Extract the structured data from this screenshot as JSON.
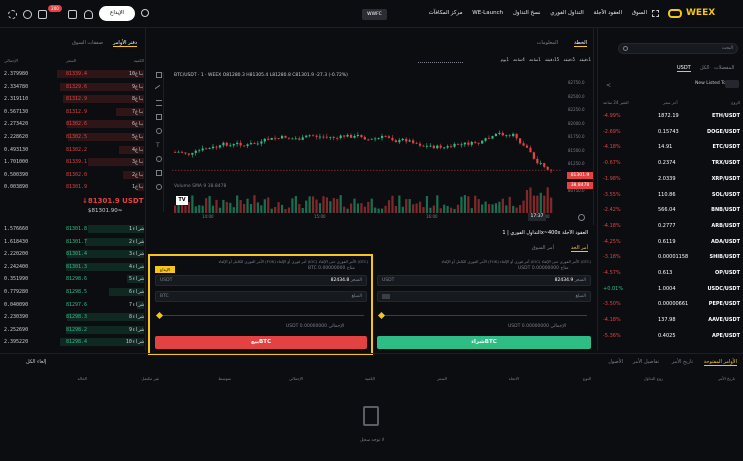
{
  "header": {
    "logo": "WEEX",
    "nav": [
      "السوق",
      "العقود الآجلة",
      "التداول الفوري",
      "نسخ التداول",
      "WE-Launch",
      "مركز المكافآت"
    ],
    "wfc": "WWFC",
    "deposit": "الإيداع",
    "badge": "200"
  },
  "orderbook": {
    "tabs": [
      "دفتر الأوامر",
      "صفقات السوق"
    ],
    "head": [
      "الإجمالي",
      "السعر",
      "الكمية"
    ],
    "asks": [
      [
        "2.379980",
        "81339.4",
        "10باع"
      ],
      [
        "2.334780",
        "81329.6",
        "9باع"
      ],
      [
        "2.319110",
        "81312.9",
        "8باع"
      ],
      [
        "0.567130",
        "81312.9",
        "7باع"
      ],
      [
        "2.273420",
        "81302.6",
        "6باع"
      ],
      [
        "2.228620",
        "81302.5",
        "5باع"
      ],
      [
        "0.493130",
        "81302.2",
        "4باع"
      ],
      [
        "1.701000",
        "81339.1",
        "3باع"
      ],
      [
        "0.500390",
        "81302.0",
        "2باع"
      ],
      [
        "0.003890",
        "81301.9",
        "1باع"
      ]
    ],
    "ask_depth": [
      0.62,
      0.6,
      0.58,
      0.2,
      0.55,
      0.54,
      0.18,
      0.4,
      0.15,
      0.05
    ],
    "mid_price": "↓81301.9 USDT",
    "mid_usd": "$81301.90≈",
    "bids": [
      [
        "1.576660",
        "81301.8",
        "1شراء"
      ],
      [
        "1.618430",
        "81301.7",
        "2شراء"
      ],
      [
        "2.220200",
        "81301.4",
        "3شراء"
      ],
      [
        "2.242400",
        "81301.3",
        "4شراء"
      ],
      [
        "0.351990",
        "81298.6",
        "5شراء"
      ],
      [
        "0.779280",
        "81298.5",
        "6شراء"
      ],
      [
        "0.040090",
        "81297.6",
        "7شراء"
      ],
      [
        "2.230390",
        "81298.3",
        "8شراء"
      ],
      [
        "2.252690",
        "81298.2",
        "9شراء"
      ],
      [
        "2.395220",
        "81298.4",
        "10شراء"
      ]
    ],
    "bid_depth": [
      0.4,
      0.42,
      0.55,
      0.56,
      0.12,
      0.25,
      0.05,
      0.55,
      0.56,
      0.6
    ]
  },
  "chart": {
    "tabs": [
      "الخطة",
      "المعلومات"
    ],
    "intervals": [
      "1دقيقة",
      "5دقيقة",
      "15دقيقة",
      "1ساعة",
      "4ساعة",
      "1يوم"
    ],
    "info": "BTC/USDT · 1 · WEEX  O81280.3 H81305.4 L81280.8 C81301.9 -27.3 (-0.72%)",
    "volume": "Volume SMA 9  38.8478",
    "price_ticks": [
      "82750.0",
      "82500.0",
      "82250.0",
      "82000.0",
      "81750.0",
      "81500.0",
      "81250.0",
      "81000.0",
      "80750.0"
    ],
    "last_price_tag": "81301.9",
    "vol_tag": "38.8478",
    "time_ticks": [
      "14:00",
      "15:00",
      "16:00",
      "17:00"
    ],
    "time_box": "17:37"
  },
  "trade": {
    "mode_bar": "التداول الفوري  |  1x~400x العقود الآجلة",
    "tabs": [
      "أمر الحد",
      "أمر السوق"
    ],
    "buy": {
      "available": "متاح 0.00000000 USDT",
      "price_label": "السعر",
      "price": "82434.9",
      "unit": "USDT",
      "amount_label": "المبلغ",
      "total": "USDT 0.00000000 الإجمالي",
      "btn": "شراءBTC"
    },
    "sell": {
      "available": "متاح 0.00000000 BTC",
      "price_label": "السعر",
      "price": "82434.8",
      "unit": "USDT",
      "amount_label": "المبلغ",
      "amount_unit": "BTC",
      "total": "USDT 0.00000000 الإجمالي",
      "btn": "بيعBTC"
    },
    "deposit_btn": "الإيداع",
    "opts": "(GTC) الأمر الفوري حتى الإلغاء  (IOC) أمر فوري أو الإلغاء  (FOK) الأمر الفوري الكامل أو الإلغاء"
  },
  "markets": {
    "search_placeholder": "البحث",
    "tabs": [
      "المفضلات",
      "الكل",
      "USDT"
    ],
    "new_listed": "New Listed Tokens",
    "head": [
      "الزوج",
      "آخر سعر",
      "التغير 24 ساعة"
    ],
    "rows": [
      [
        "ETH",
        "1872.19",
        "-4.99%"
      ],
      [
        "DOGE",
        "0.15743",
        "-2.69%"
      ],
      [
        "ETC",
        "14.91",
        "-4.18%"
      ],
      [
        "TRX",
        "0.2374",
        "-0.67%"
      ],
      [
        "XRP",
        "2.0339",
        "-1.98%"
      ],
      [
        "SOL",
        "110.86",
        "-3.55%"
      ],
      [
        "BNB",
        "566.04",
        "-2.42%"
      ],
      [
        "ARB",
        "0.2777",
        "-4.18%"
      ],
      [
        "ADA",
        "0.6119",
        "-4.25%"
      ],
      [
        "SHIB",
        "0.00001158",
        "-3.18%"
      ],
      [
        "OP",
        "0.613",
        "-4.57%"
      ],
      [
        "USDC",
        "1.0004",
        "+0.01%"
      ],
      [
        "PEPE",
        "0.00000661",
        "-3.50%"
      ],
      [
        "AAVE",
        "137.98",
        "-4.18%"
      ],
      [
        "APE",
        "0.4025",
        "-5.36%"
      ]
    ]
  },
  "orders": {
    "tabs": [
      "الأوامر المفتوحة",
      "تاريخ الأمر",
      "تفاصيل الأمر",
      "الأصول"
    ],
    "right_tab": "إلغاء الكل",
    "cols": [
      "تاريخ الأمر",
      "زوج التداول",
      "النوع",
      "الاتجاه",
      "السعر",
      "الكمية",
      "الإجمالي",
      "متوسط",
      "غير مكتمل",
      "الحالة"
    ],
    "empty": "لا توجد سجل"
  }
}
